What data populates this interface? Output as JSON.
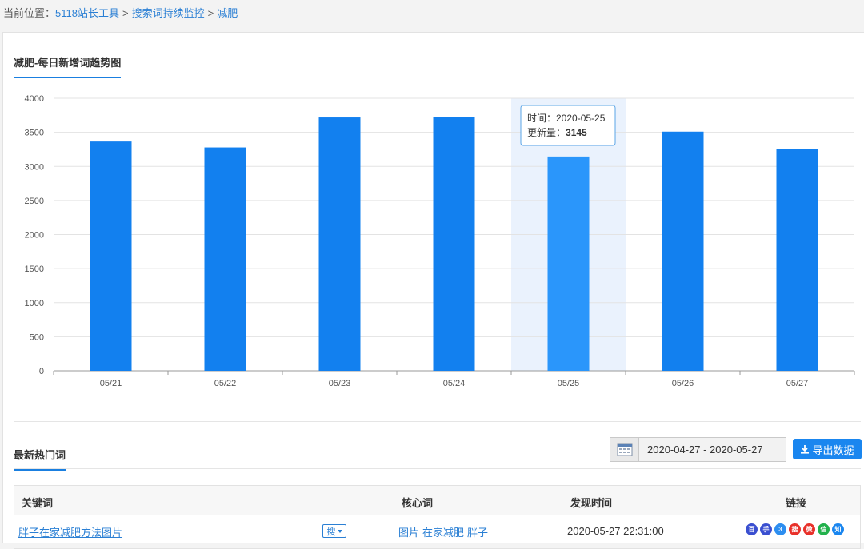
{
  "breadcrumb": {
    "prefix": "当前位置：",
    "items": [
      "5118站长工具",
      "搜索词持续监控",
      "减肥"
    ],
    "sep": ">"
  },
  "chart_title": "减肥-每日新增词趋势图",
  "chart_data": {
    "type": "bar",
    "categories": [
      "05/21",
      "05/22",
      "05/23",
      "05/24",
      "05/25",
      "05/26",
      "05/27"
    ],
    "values": [
      3365,
      3278,
      3718,
      3728,
      3145,
      3510,
      3258
    ],
    "ylim": [
      0,
      4000
    ],
    "yticks": [
      0,
      500,
      1000,
      1500,
      2000,
      2500,
      3000,
      3500,
      4000
    ],
    "grid": true,
    "colors": {
      "bar": "#1280ef",
      "bar_highlight": "#2a96fb",
      "highlight_band": "#eaf2fd"
    },
    "highlight_index": 4,
    "tooltip": {
      "time_label": "时间：",
      "time": "2020-05-25",
      "value_label": "更新量：",
      "value": "3145"
    }
  },
  "hot_title": "最新热门词",
  "date_range": "2020-04-27 - 2020-05-27",
  "export_label": "导出数据",
  "table": {
    "headers": {
      "keyword": "关键词",
      "core": "核心词",
      "found": "发现时间",
      "links": "链接"
    },
    "rows": [
      {
        "keyword": "胖子在家减肥方法图片",
        "search_label": "搜",
        "core": [
          "图片",
          "在家减肥",
          "胖子"
        ],
        "found": "2020-05-27 22:31:00"
      }
    ],
    "link_icons": [
      {
        "name": "baidu-icon",
        "glyph": "百",
        "color": "#3a4fd0"
      },
      {
        "name": "baidu-mobile-icon",
        "glyph": "手",
        "color": "#3a4fd0"
      },
      {
        "name": "360-icon",
        "glyph": "3",
        "color": "#2d8ef0"
      },
      {
        "name": "sogou-icon",
        "glyph": "搜",
        "color": "#e8312a"
      },
      {
        "name": "weibo-icon",
        "glyph": "微",
        "color": "#e8312a"
      },
      {
        "name": "wechat-icon",
        "glyph": "信",
        "color": "#22b14c"
      },
      {
        "name": "zhihu-icon",
        "glyph": "知",
        "color": "#1a86ef"
      }
    ]
  }
}
